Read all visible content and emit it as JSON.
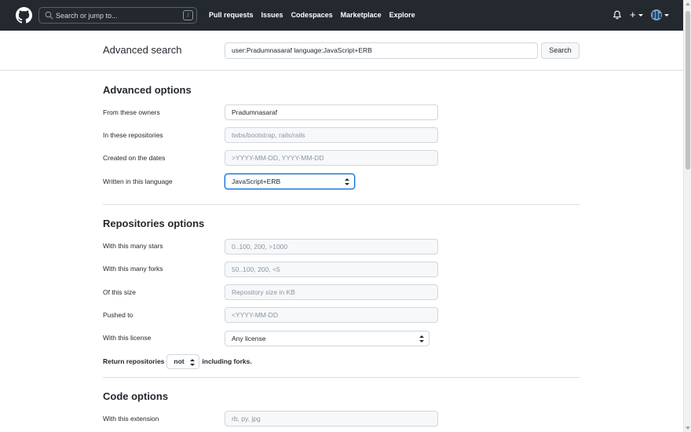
{
  "header": {
    "search_placeholder": "Search or jump to...",
    "slash_key": "/",
    "nav": [
      "Pull requests",
      "Issues",
      "Codespaces",
      "Marketplace",
      "Explore"
    ],
    "plus": "+"
  },
  "subheader": {
    "title": "Advanced search",
    "query": "user:Pradumnasaraf language:JavaScript+ERB",
    "search_button": "Search"
  },
  "advanced_options": {
    "title": "Advanced options",
    "owners_label": "From these owners",
    "owners_value": "Pradumnasaraf",
    "repos_label": "In these repositories",
    "repos_placeholder": "twbs/bootstrap, rails/rails",
    "dates_label": "Created on the dates",
    "dates_placeholder": ">YYYY-MM-DD, YYYY-MM-DD",
    "language_label": "Written in this language",
    "language_value": "JavaScript+ERB"
  },
  "repositories_options": {
    "title": "Repositories options",
    "stars_label": "With this many stars",
    "stars_placeholder": "0..100, 200, >1000",
    "forks_label": "With this many forks",
    "forks_placeholder": "50..100, 200, <5",
    "size_label": "Of this size",
    "size_placeholder": "Repository size in KB",
    "pushed_label": "Pushed to",
    "pushed_placeholder": "<YYYY-MM-DD",
    "license_label": "With this license",
    "license_value": "Any license",
    "return_prefix": "Return repositories",
    "return_value": "not",
    "return_suffix": "including forks."
  },
  "code_options": {
    "title": "Code options",
    "extension_label": "With this extension",
    "extension_placeholder": "rb, py, jpg"
  },
  "colors": {
    "header_bg": "#24292f",
    "focus_border": "#0969da"
  }
}
